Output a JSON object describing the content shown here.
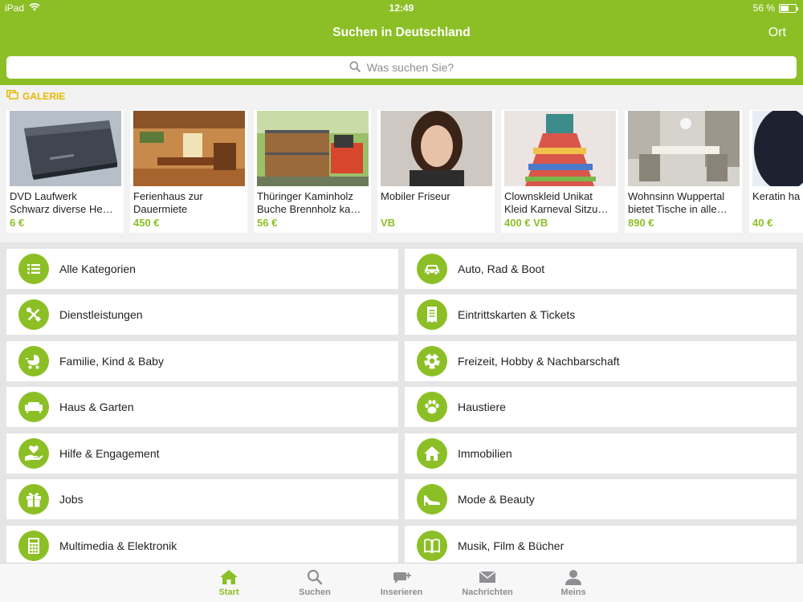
{
  "status_bar": {
    "device": "iPad",
    "time": "12:49",
    "battery": "56 %"
  },
  "header": {
    "title": "Suchen in Deutschland",
    "right_button": "Ort"
  },
  "search": {
    "placeholder": "Was suchen Sie?"
  },
  "gallery": {
    "label": "GALERIE",
    "items": [
      {
        "line1": "DVD Laufwerk",
        "line2": "Schwarz diverse He…",
        "price": "6 €",
        "image": "dvd-drive-photo"
      },
      {
        "line1": "Ferienhaus zur",
        "line2": "Dauermiete",
        "price": "450 €",
        "image": "holiday-house-interior-photo"
      },
      {
        "line1": "Thüringer Kaminholz",
        "line2": "Buche Brennholz ka…",
        "price": "56 €",
        "image": "firewood-photo"
      },
      {
        "line1": "Mobiler Friseur",
        "line2": "",
        "price": "VB",
        "image": "hairdresser-portrait-photo"
      },
      {
        "line1": "Clownskleid Unikat",
        "line2": "Kleid Karneval Sitzu…",
        "price": "400 € VB",
        "image": "clown-dress-photo"
      },
      {
        "line1": "Wohnsinn Wuppertal",
        "line2": "bietet Tische in alle…",
        "price": "890 €",
        "image": "dining-table-photo"
      },
      {
        "line1": "Keratin ha",
        "line2": "",
        "price": "40 €",
        "image": "hair-photo"
      }
    ]
  },
  "categories": [
    {
      "label": "Alle Kategorien",
      "icon": "list-icon"
    },
    {
      "label": "Auto, Rad & Boot",
      "icon": "car-icon"
    },
    {
      "label": "Dienstleistungen",
      "icon": "tools-icon"
    },
    {
      "label": "Eintrittskarten & Tickets",
      "icon": "ticket-icon"
    },
    {
      "label": "Familie, Kind & Baby",
      "icon": "stroller-icon"
    },
    {
      "label": "Freizeit, Hobby & Nachbarschaft",
      "icon": "soccer-ball-icon"
    },
    {
      "label": "Haus & Garten",
      "icon": "sofa-icon"
    },
    {
      "label": "Haustiere",
      "icon": "paw-icon"
    },
    {
      "label": "Hilfe & Engagement",
      "icon": "heart-hand-icon"
    },
    {
      "label": "Immobilien",
      "icon": "house-icon"
    },
    {
      "label": "Jobs",
      "icon": "gift-briefcase-icon"
    },
    {
      "label": "Mode & Beauty",
      "icon": "high-heel-icon"
    },
    {
      "label": "Multimedia & Elektronik",
      "icon": "calculator-icon"
    },
    {
      "label": "Musik, Film & Bücher",
      "icon": "book-icon"
    }
  ],
  "tabs": [
    {
      "label": "Start",
      "icon": "home-icon",
      "active": true
    },
    {
      "label": "Suchen",
      "icon": "search-icon",
      "active": false
    },
    {
      "label": "Inserieren",
      "icon": "post-ad-icon",
      "active": false
    },
    {
      "label": "Nachrichten",
      "icon": "envelope-icon",
      "active": false
    },
    {
      "label": "Meins",
      "icon": "person-icon",
      "active": false
    }
  ],
  "colors": {
    "brand_green": "#8cbf26",
    "gallery_yellow": "#e5b900",
    "tab_inactive": "#8e8e93"
  }
}
